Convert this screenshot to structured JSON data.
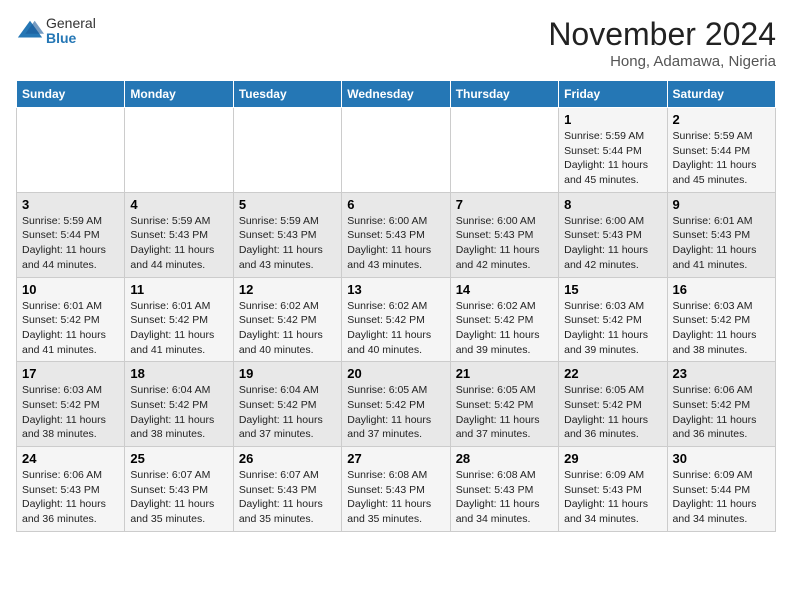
{
  "header": {
    "logo_line1": "General",
    "logo_line2": "Blue",
    "month_year": "November 2024",
    "location": "Hong, Adamawa, Nigeria"
  },
  "weekdays": [
    "Sunday",
    "Monday",
    "Tuesday",
    "Wednesday",
    "Thursday",
    "Friday",
    "Saturday"
  ],
  "weeks": [
    [
      {
        "day": "",
        "sunrise": "",
        "sunset": "",
        "daylight": ""
      },
      {
        "day": "",
        "sunrise": "",
        "sunset": "",
        "daylight": ""
      },
      {
        "day": "",
        "sunrise": "",
        "sunset": "",
        "daylight": ""
      },
      {
        "day": "",
        "sunrise": "",
        "sunset": "",
        "daylight": ""
      },
      {
        "day": "",
        "sunrise": "",
        "sunset": "",
        "daylight": ""
      },
      {
        "day": "1",
        "sunrise": "Sunrise: 5:59 AM",
        "sunset": "Sunset: 5:44 PM",
        "daylight": "Daylight: 11 hours and 45 minutes."
      },
      {
        "day": "2",
        "sunrise": "Sunrise: 5:59 AM",
        "sunset": "Sunset: 5:44 PM",
        "daylight": "Daylight: 11 hours and 45 minutes."
      }
    ],
    [
      {
        "day": "3",
        "sunrise": "Sunrise: 5:59 AM",
        "sunset": "Sunset: 5:44 PM",
        "daylight": "Daylight: 11 hours and 44 minutes."
      },
      {
        "day": "4",
        "sunrise": "Sunrise: 5:59 AM",
        "sunset": "Sunset: 5:43 PM",
        "daylight": "Daylight: 11 hours and 44 minutes."
      },
      {
        "day": "5",
        "sunrise": "Sunrise: 5:59 AM",
        "sunset": "Sunset: 5:43 PM",
        "daylight": "Daylight: 11 hours and 43 minutes."
      },
      {
        "day": "6",
        "sunrise": "Sunrise: 6:00 AM",
        "sunset": "Sunset: 5:43 PM",
        "daylight": "Daylight: 11 hours and 43 minutes."
      },
      {
        "day": "7",
        "sunrise": "Sunrise: 6:00 AM",
        "sunset": "Sunset: 5:43 PM",
        "daylight": "Daylight: 11 hours and 42 minutes."
      },
      {
        "day": "8",
        "sunrise": "Sunrise: 6:00 AM",
        "sunset": "Sunset: 5:43 PM",
        "daylight": "Daylight: 11 hours and 42 minutes."
      },
      {
        "day": "9",
        "sunrise": "Sunrise: 6:01 AM",
        "sunset": "Sunset: 5:43 PM",
        "daylight": "Daylight: 11 hours and 41 minutes."
      }
    ],
    [
      {
        "day": "10",
        "sunrise": "Sunrise: 6:01 AM",
        "sunset": "Sunset: 5:42 PM",
        "daylight": "Daylight: 11 hours and 41 minutes."
      },
      {
        "day": "11",
        "sunrise": "Sunrise: 6:01 AM",
        "sunset": "Sunset: 5:42 PM",
        "daylight": "Daylight: 11 hours and 41 minutes."
      },
      {
        "day": "12",
        "sunrise": "Sunrise: 6:02 AM",
        "sunset": "Sunset: 5:42 PM",
        "daylight": "Daylight: 11 hours and 40 minutes."
      },
      {
        "day": "13",
        "sunrise": "Sunrise: 6:02 AM",
        "sunset": "Sunset: 5:42 PM",
        "daylight": "Daylight: 11 hours and 40 minutes."
      },
      {
        "day": "14",
        "sunrise": "Sunrise: 6:02 AM",
        "sunset": "Sunset: 5:42 PM",
        "daylight": "Daylight: 11 hours and 39 minutes."
      },
      {
        "day": "15",
        "sunrise": "Sunrise: 6:03 AM",
        "sunset": "Sunset: 5:42 PM",
        "daylight": "Daylight: 11 hours and 39 minutes."
      },
      {
        "day": "16",
        "sunrise": "Sunrise: 6:03 AM",
        "sunset": "Sunset: 5:42 PM",
        "daylight": "Daylight: 11 hours and 38 minutes."
      }
    ],
    [
      {
        "day": "17",
        "sunrise": "Sunrise: 6:03 AM",
        "sunset": "Sunset: 5:42 PM",
        "daylight": "Daylight: 11 hours and 38 minutes."
      },
      {
        "day": "18",
        "sunrise": "Sunrise: 6:04 AM",
        "sunset": "Sunset: 5:42 PM",
        "daylight": "Daylight: 11 hours and 38 minutes."
      },
      {
        "day": "19",
        "sunrise": "Sunrise: 6:04 AM",
        "sunset": "Sunset: 5:42 PM",
        "daylight": "Daylight: 11 hours and 37 minutes."
      },
      {
        "day": "20",
        "sunrise": "Sunrise: 6:05 AM",
        "sunset": "Sunset: 5:42 PM",
        "daylight": "Daylight: 11 hours and 37 minutes."
      },
      {
        "day": "21",
        "sunrise": "Sunrise: 6:05 AM",
        "sunset": "Sunset: 5:42 PM",
        "daylight": "Daylight: 11 hours and 37 minutes."
      },
      {
        "day": "22",
        "sunrise": "Sunrise: 6:05 AM",
        "sunset": "Sunset: 5:42 PM",
        "daylight": "Daylight: 11 hours and 36 minutes."
      },
      {
        "day": "23",
        "sunrise": "Sunrise: 6:06 AM",
        "sunset": "Sunset: 5:42 PM",
        "daylight": "Daylight: 11 hours and 36 minutes."
      }
    ],
    [
      {
        "day": "24",
        "sunrise": "Sunrise: 6:06 AM",
        "sunset": "Sunset: 5:43 PM",
        "daylight": "Daylight: 11 hours and 36 minutes."
      },
      {
        "day": "25",
        "sunrise": "Sunrise: 6:07 AM",
        "sunset": "Sunset: 5:43 PM",
        "daylight": "Daylight: 11 hours and 35 minutes."
      },
      {
        "day": "26",
        "sunrise": "Sunrise: 6:07 AM",
        "sunset": "Sunset: 5:43 PM",
        "daylight": "Daylight: 11 hours and 35 minutes."
      },
      {
        "day": "27",
        "sunrise": "Sunrise: 6:08 AM",
        "sunset": "Sunset: 5:43 PM",
        "daylight": "Daylight: 11 hours and 35 minutes."
      },
      {
        "day": "28",
        "sunrise": "Sunrise: 6:08 AM",
        "sunset": "Sunset: 5:43 PM",
        "daylight": "Daylight: 11 hours and 34 minutes."
      },
      {
        "day": "29",
        "sunrise": "Sunrise: 6:09 AM",
        "sunset": "Sunset: 5:43 PM",
        "daylight": "Daylight: 11 hours and 34 minutes."
      },
      {
        "day": "30",
        "sunrise": "Sunrise: 6:09 AM",
        "sunset": "Sunset: 5:44 PM",
        "daylight": "Daylight: 11 hours and 34 minutes."
      }
    ]
  ]
}
